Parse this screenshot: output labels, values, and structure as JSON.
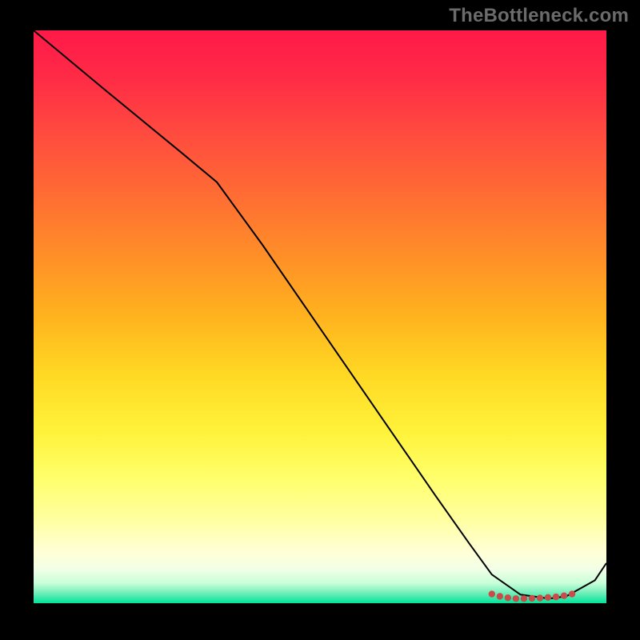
{
  "watermark": "TheBottleneck.com",
  "chart_data": {
    "type": "line",
    "title": "",
    "xlabel": "",
    "ylabel": "",
    "xlim": [
      0,
      100
    ],
    "ylim": [
      0,
      100
    ],
    "grid": false,
    "series": [
      {
        "name": "curve",
        "color": "#000000",
        "x": [
          0,
          12,
          26,
          32,
          40,
          50,
          60,
          70,
          76,
          80,
          85,
          90,
          93,
          98,
          100
        ],
        "y": [
          100,
          90,
          78.5,
          73.5,
          62.5,
          48,
          33.5,
          19,
          10.5,
          5,
          1.5,
          0.8,
          1.2,
          4,
          7
        ]
      }
    ],
    "markers": {
      "name": "bottom-cluster",
      "color": "#cc4a4a",
      "size": 4.2,
      "x": [
        80,
        81.4,
        82.8,
        84.2,
        85.6,
        87,
        88.4,
        89.8,
        91.2,
        92.6,
        94
      ],
      "y": [
        1.6,
        1.2,
        0.95,
        0.8,
        0.8,
        0.85,
        0.9,
        1.0,
        1.1,
        1.3,
        1.6
      ]
    }
  }
}
